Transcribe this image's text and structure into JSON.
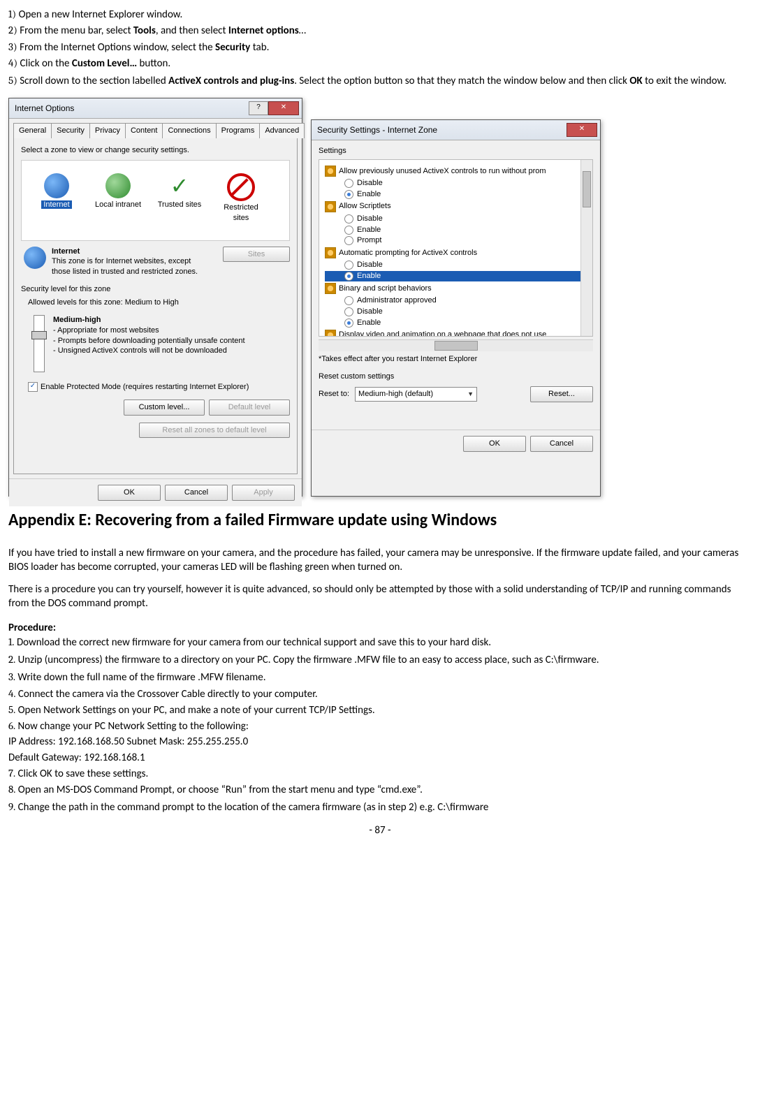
{
  "steps_top": {
    "s1": {
      "n": "1)",
      "t1": "Open a new Internet Explorer window."
    },
    "s2": {
      "n": "2)",
      "t1": "From the menu bar, select ",
      "b1": "Tools",
      "t2": ", and then select ",
      "b2": "Internet options",
      "t3": "…"
    },
    "s3": {
      "n": "3)",
      "t1": "From the Internet Options window, select the ",
      "b1": "Security",
      "t2": " tab."
    },
    "s4": {
      "n": "4)",
      "t1": "Click on the ",
      "b1": "Custom Level…",
      "t2": " button."
    },
    "s5": {
      "n": "5)",
      "t1": "Scroll down to the section labelled ",
      "b1": "ActiveX controls and plug-ins",
      "t2": ". Select the option button so that they match the window below and then click ",
      "b2": "OK",
      "t3": " to exit the window."
    }
  },
  "dialog1": {
    "title": "Internet Options",
    "tabs": [
      "General",
      "Security",
      "Privacy",
      "Content",
      "Connections",
      "Programs",
      "Advanced"
    ],
    "zone_heading": "Select a zone to view or change security settings.",
    "zones": {
      "internet": "Internet",
      "local": "Local intranet",
      "trusted": "Trusted sites",
      "restricted": "Restricted sites"
    },
    "zone_title": "Internet",
    "zone_desc": "This zone is for Internet websites, except those listed in trusted and restricted zones.",
    "sites_btn": "Sites",
    "sec_level": "Security level for this zone",
    "allowed": "Allowed levels for this zone: Medium to High",
    "level_name": "Medium-high",
    "bullet1": "- Appropriate for most websites",
    "bullet2": "- Prompts before downloading potentially unsafe content",
    "bullet3": "- Unsigned ActiveX controls will not be downloaded",
    "protected": "Enable Protected Mode (requires restarting Internet Explorer)",
    "custom": "Custom level...",
    "default": "Default level",
    "reset": "Reset all zones to default level",
    "ok": "OK",
    "cancel": "Cancel",
    "apply": "Apply"
  },
  "dialog2": {
    "title": "Security Settings - Internet Zone",
    "settings": "Settings",
    "g1": "Allow previously unused ActiveX controls to run without prom",
    "g2": "Allow Scriptlets",
    "g3": "Automatic prompting for ActiveX controls",
    "g4": "Binary and script behaviors",
    "g5": "Display video and animation on a webpage that does not use",
    "r_disable": "Disable",
    "r_enable": "Enable",
    "r_prompt": "Prompt",
    "r_admin": "Administrator approved",
    "footnote": "*Takes effect after you restart Internet Explorer",
    "reset_custom": "Reset custom settings",
    "reset_to": "Reset to:",
    "reset_val": "Medium-high (default)",
    "reset_btn": "Reset...",
    "ok": "OK",
    "cancel": "Cancel"
  },
  "appendix_title": "Appendix E: Recovering from a failed Firmware update using Windows",
  "para1": "If you have tried to install a new firmware on your camera, and the procedure has failed, your camera may be unresponsive. If the firmware update failed, and your cameras BIOS loader has become corrupted, your cameras LED will be flashing green when turned on.",
  "para2": "There is a procedure you can try yourself, however it is quite advanced, so should only be attempted by those with a solid understanding of TCP/IP and running commands from the DOS command prompt.",
  "procedure": "Procedure:",
  "steps_bottom": {
    "s1": {
      "n": "1.",
      "t": "Download the correct new firmware for your camera from our technical support and save this to your hard disk."
    },
    "s2": {
      "n": "2.",
      "t": "Unzip (uncompress) the firmware to a directory on your PC. Copy the firmware .MFW file to an easy to access place, such as C:\\firmware."
    },
    "s3": {
      "n": "3.",
      "t": "Write down the full name of the firmware .MFW filename."
    },
    "s4": {
      "n": "4.",
      "t": "Connect the camera via the Crossover Cable directly to your computer."
    },
    "s5": {
      "n": "5.",
      "t": "Open Network Settings on your PC, and make a note of your current TCP/IP Settings."
    },
    "s6": {
      "n": "6.",
      "t": "Now change your PC Network Setting to the following:"
    },
    "s6a": "IP Address: 192.168.168.50 Subnet Mask: 255.255.255.0",
    "s6b": "Default Gateway: 192.168.168.1",
    "s7": {
      "n": "7.",
      "t": "Click OK to save these settings."
    },
    "s8": {
      "n": "8.",
      "t": "Open an MS-DOS Command Prompt, or choose “Run” from the start menu and type “cmd.exe”."
    },
    "s9": {
      "n": "9.",
      "t": "Change the path in the command prompt to the location of the camera firmware (as in step 2) e.g. C:\\firmware"
    }
  },
  "page": "- 87 -"
}
